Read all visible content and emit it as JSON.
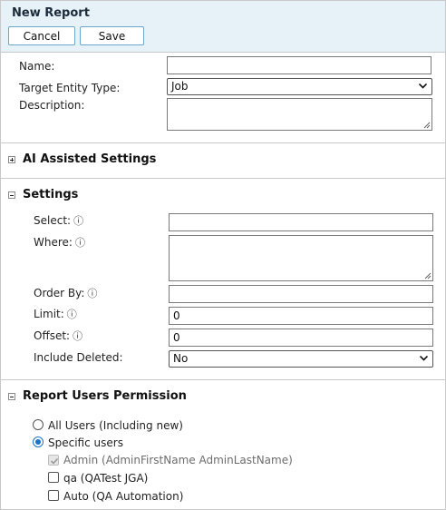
{
  "header": {
    "title": "New Report",
    "cancel_label": "Cancel",
    "save_label": "Save"
  },
  "form": {
    "name_label": "Name:",
    "name_value": "",
    "target_label": "Target Entity Type:",
    "target_value": "Job",
    "description_label": "Description:",
    "description_value": ""
  },
  "ai_section": {
    "title": "AI Assisted Settings",
    "expanded": false
  },
  "settings": {
    "title": "Settings",
    "expanded": true,
    "select_label": "Select:",
    "select_value": "",
    "where_label": "Where:",
    "where_value": "",
    "orderby_label": "Order By:",
    "orderby_value": "",
    "limit_label": "Limit:",
    "limit_value": "0",
    "offset_label": "Offset:",
    "offset_value": "0",
    "deleted_label": "Include Deleted:",
    "deleted_value": "No",
    "info_glyph": "ⓘ"
  },
  "permissions": {
    "title": "Report Users Permission",
    "expanded": true,
    "all_users_label": "All Users (Including new)",
    "specific_label": "Specific users",
    "selected": "specific",
    "users": [
      {
        "label": "Admin (AdminFirstName AdminLastName)",
        "checked": true,
        "disabled": true
      },
      {
        "label": "qa (QATest JGA)",
        "checked": false,
        "disabled": false
      },
      {
        "label": "Auto (QA Automation)",
        "checked": false,
        "disabled": false
      }
    ]
  },
  "colors": {
    "header_bg": "#e6f1f8",
    "button_border": "#6ba8cf",
    "radio_accent": "#1a73c8"
  }
}
